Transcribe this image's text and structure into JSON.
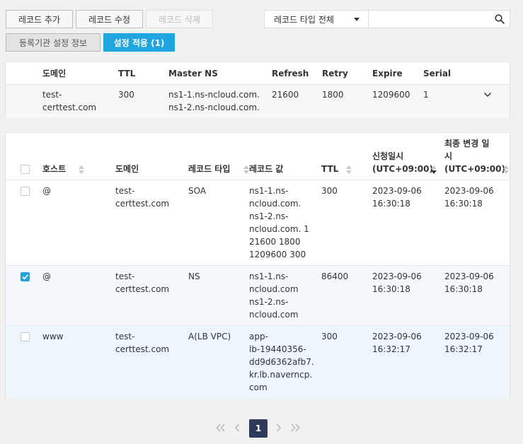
{
  "toolbar": {
    "add": "레코드 추가",
    "edit": "레코드 수정",
    "delete": "레코드 삭제",
    "registrar": "등록기관 설정 정보",
    "apply": "설정 적용 (1)",
    "record_type_select": "레코드 타입 전체",
    "search_placeholder": ""
  },
  "domain_info": {
    "headers": [
      "도메인",
      "TTL",
      "Master NS",
      "Refresh",
      "Retry",
      "Expire",
      "Serial"
    ],
    "row": {
      "domain": [
        "test-",
        "certtest.com"
      ],
      "ttl": "300",
      "master_ns": [
        "ns1-1.ns-ncloud.com.",
        "ns1-2.ns-ncloud.com."
      ],
      "refresh": "21600",
      "retry": "1800",
      "expire": "1209600",
      "serial": "1"
    }
  },
  "records": {
    "headers": {
      "host": "호스트",
      "domain": "도메인",
      "type": "레코드 타입",
      "value": "레코드 값",
      "ttl": "TTL",
      "requested_l1": "신청일시",
      "requested_l2": "(UTC+09:00)",
      "modified_l1": "최종 변경 일",
      "modified_l2": "시",
      "modified_l3": "(UTC+09:00)"
    },
    "rows": [
      {
        "checked": false,
        "host": "@",
        "domain": [
          "test-",
          "certtest.com"
        ],
        "type": "SOA",
        "value": [
          "ns1-1.ns-",
          "ncloud.com.",
          "ns1-2.ns-",
          "ncloud.com. 1",
          "21600 1800",
          "1209600 300"
        ],
        "ttl": "300",
        "requested": [
          "2023-09-06",
          "16:30:18"
        ],
        "modified": [
          "2023-09-06",
          "16:30:18"
        ]
      },
      {
        "checked": true,
        "host": "@",
        "domain": [
          "test-",
          "certtest.com"
        ],
        "type": "NS",
        "value": [
          "ns1-1.ns-",
          "ncloud.com",
          "ns1-2.ns-",
          "ncloud.com"
        ],
        "ttl": "86400",
        "requested": [
          "2023-09-06",
          "16:30:18"
        ],
        "modified": [
          "2023-09-06",
          "16:30:18"
        ]
      },
      {
        "checked": false,
        "host": "www",
        "domain": [
          "test-",
          "certtest.com"
        ],
        "type": "A(LB VPC)",
        "value": [
          "app-",
          "lb-19440356-",
          "dd9d6362afb7.",
          "kr.lb.naverncp.",
          "com"
        ],
        "ttl": "300",
        "requested": [
          "2023-09-06",
          "16:32:17"
        ],
        "modified": [
          "2023-09-06",
          "16:32:17"
        ]
      }
    ]
  },
  "pagination": {
    "current": "1",
    "first_icon": "double-chevron-left-icon",
    "prev_icon": "chevron-left-icon",
    "next_icon": "chevron-right-icon",
    "last_icon": "double-chevron-right-icon"
  },
  "colors": {
    "accent": "#1fa5e0",
    "page_active": "#2d3a5a",
    "selected_row": "#f5f9fd",
    "highlight_row": "#edf6fd"
  }
}
